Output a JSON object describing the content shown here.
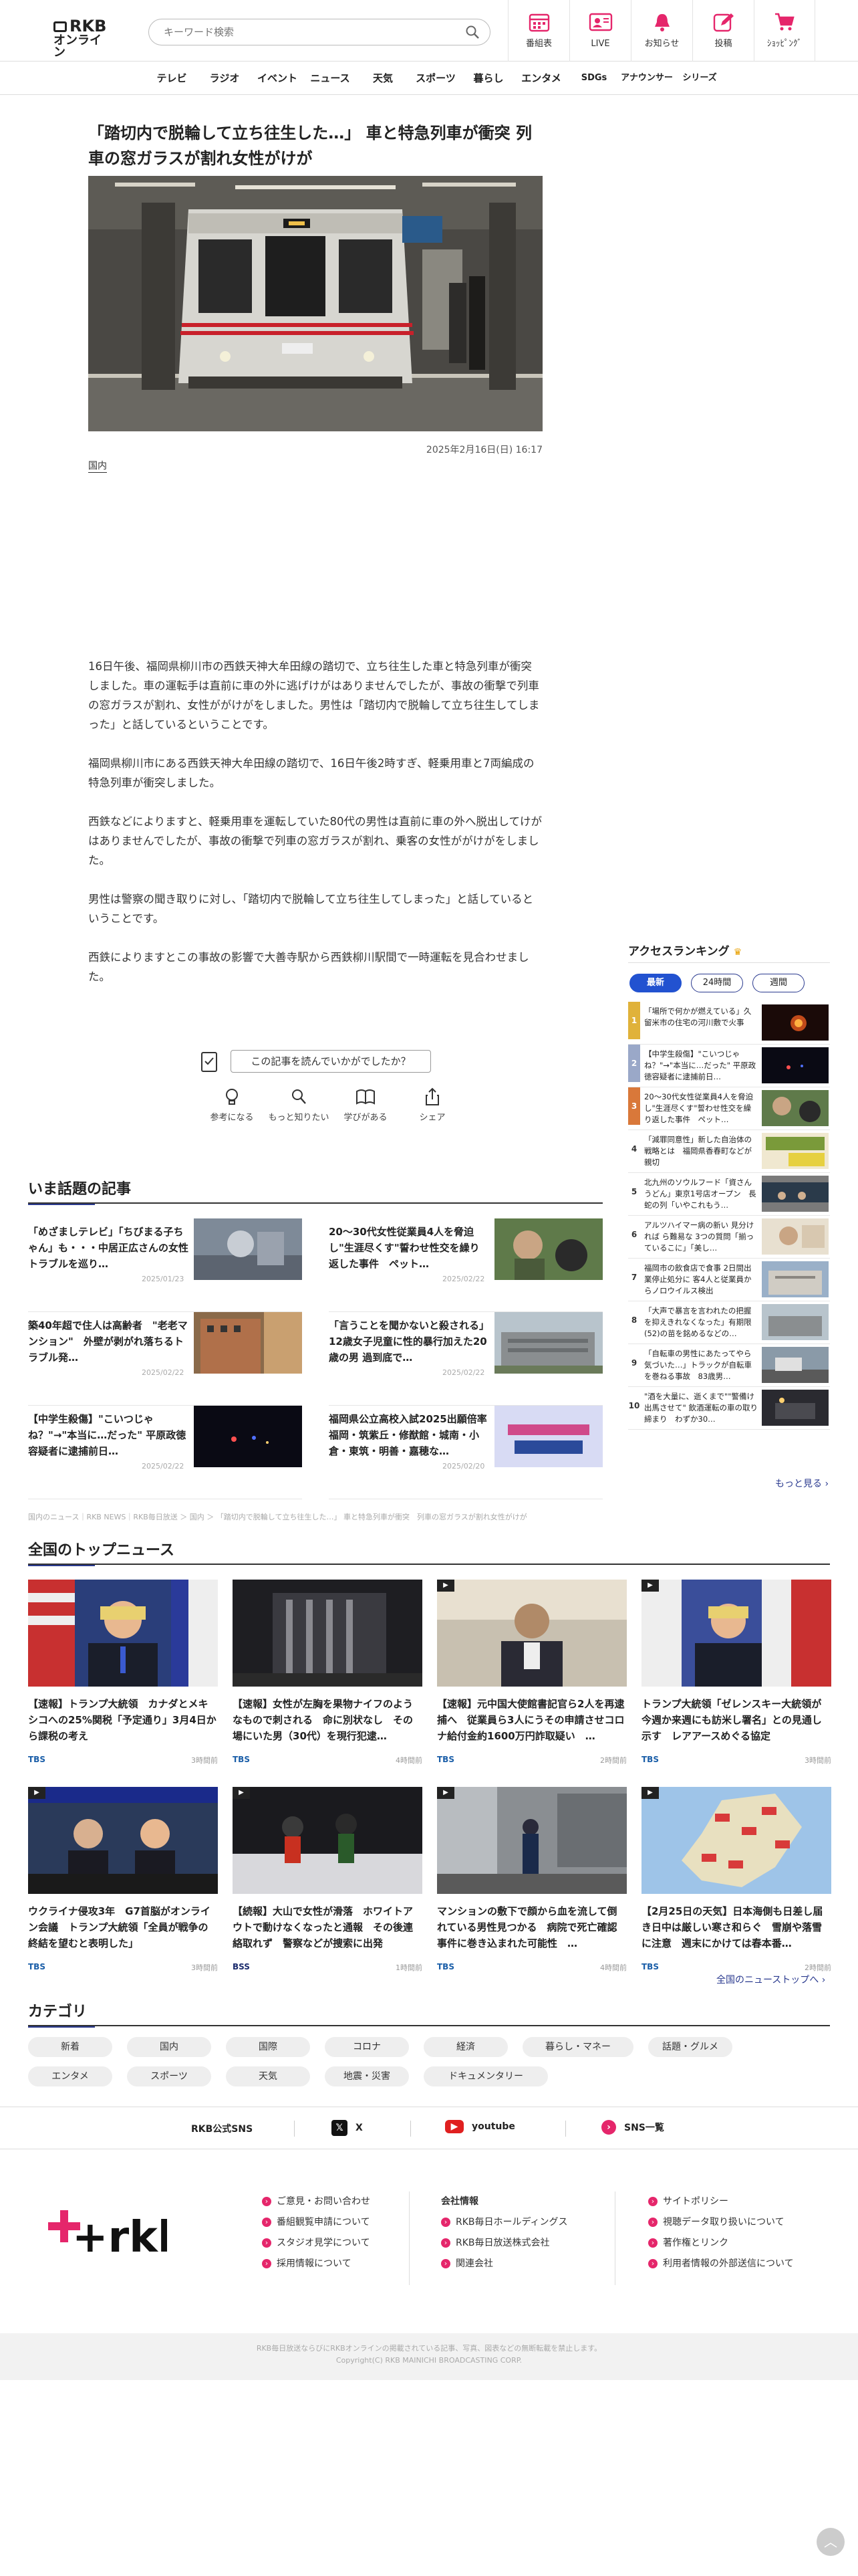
{
  "header": {
    "logo_line1": "RKB",
    "logo_line2": "オンライン",
    "search_placeholder": "キーワード検索",
    "icons": [
      {
        "label": "番組表",
        "icon": "calendar-icon"
      },
      {
        "label": "LIVE",
        "icon": "live-icon"
      },
      {
        "label": "お知らせ",
        "icon": "bell-icon"
      },
      {
        "label": "投稿",
        "icon": "post-icon"
      },
      {
        "label": "ｼｮｯﾋﾟﾝｸﾞ",
        "icon": "cart-icon"
      }
    ]
  },
  "nav": [
    "テレビ",
    "ラジオ",
    "イベント",
    "ニュース",
    "天気",
    "スポーツ",
    "暮らし",
    "エンタメ",
    "SDGs",
    "アナウンサー",
    "シリーズ"
  ],
  "article": {
    "title": "「踏切内で脱輪して立ち往生した…」 車と特急列車が衝突 列車の窓ガラスが割れ女性がけが",
    "date": "2025年2月16日(日) 16:17",
    "category": "国内",
    "paragraphs": [
      "16日午後、福岡県柳川市の西鉄天神大牟田線の踏切で、立ち往生した車と特急列車が衝突しました。車の運転手は直前に車の外に逃げけがはありませんでしたが、事故の衝撃で列車の窓ガラスが割れ、女性ががけがをしました。男性は「踏切内で脱輪して立ち往生してしまった」と話しているということです。",
      "福岡県柳川市にある西鉄天神大牟田線の踏切で、16日午後2時すぎ、軽乗用車と7両編成の特急列車が衝突しました。",
      "西鉄などによりますと、軽乗用車を運転していた80代の男性は直前に車の外へ脱出してけがはありませんでしたが、事故の衝撃で列車の窓ガラスが割れ、乗客の女性ががけがをしました。",
      "男性は警察の聞き取りに対し、「踏切内で脱輪して立ち往生してしまった」と話しているということです。",
      "西鉄によりますとこの事故の影響で大善寺駅から西鉄柳川駅間で一時運転を見合わせました。"
    ]
  },
  "survey": {
    "question": "この記事を読んでいかがでしたか？",
    "reactions": [
      {
        "label": "参考になる",
        "icon": "lightbulb-icon"
      },
      {
        "label": "もっと知りたい",
        "icon": "search-icon"
      },
      {
        "label": "学びがある",
        "icon": "book-icon"
      },
      {
        "label": "シェア",
        "icon": "share-icon"
      }
    ]
  },
  "popular": {
    "title": "いま話題の記事",
    "items": [
      {
        "title": "「めざましテレビ」「ちびまる子ちゃん」も・・・中居正広さんの女性トラブルを巡り…",
        "date": "2025/01/23"
      },
      {
        "title": "20～30代女性従業員4人を脅迫し\"生涯尽くす\"誓わせ性交を繰り返した事件　ペット…",
        "date": "2025/02/22"
      },
      {
        "title": "築40年超で住人は高齢者　\"老老マンション\"　外壁が剥がれ落ちるトラブル発…",
        "date": "2025/02/22"
      },
      {
        "title": "「言うことを聞かないと殺される」12歳女子児童に性的暴行加えた20歳の男 過到底で…",
        "date": "2025/02/22"
      },
      {
        "title": "【中学生殺傷】\"こいつじゃね？\"→\"本当に…だった\" 平原政徳容疑者に逮捕前日…",
        "date": "2025/02/22"
      },
      {
        "title": "福岡県公立高校入試2025出願倍率　福岡・筑紫丘・修猷館・城南・小倉・東筑・明善・嘉穂な…",
        "date": "2025/02/20"
      }
    ]
  },
  "breadcrumb": "国内のニュース｜RKB NEWS｜RKB毎日放送 ＞ 国内 ＞ 「踏切内で脱輪して立ち往生した…」 車と特急列車が衝突　列車の窓ガラスが割れ女性がけが",
  "ranking": {
    "title": "アクセスランキング",
    "crown": "♛",
    "tabs": [
      "最新",
      "24時間",
      "週間"
    ],
    "items": [
      {
        "n": "1",
        "title": "「場所で何かが燃えている」久留米市の住宅の河川敷で火事"
      },
      {
        "n": "2",
        "title": "【中学生殺傷】\"こいつじゃね？\"→\"本当に…だった\" 平原政徳容疑者に逮捕前日…"
      },
      {
        "n": "3",
        "title": "20～30代女性従業員4人を脅迫し\"生涯尽くす\"誓わせ性交を繰り返した事件　ペット…"
      },
      {
        "n": "4",
        "title": "「減罪同意性」新した自治体の戦略とは　福岡県香春町などが親切"
      },
      {
        "n": "5",
        "title": "北九州のソウルフード「資さんうどん」東京1号店オープン　長蛇の列「いやこれもう…"
      },
      {
        "n": "6",
        "title": "アルツハイマー病の新い 見分ければ ら難易な 3つの質問「揃っているこに」「美し…"
      },
      {
        "n": "7",
        "title": "福岡市の飲食店で食事 2日間出業停止処分に 客4人と従業員からノロウイルス検出"
      },
      {
        "n": "8",
        "title": "「大声で暴言を言われたの把握を抑えきれなくなった」有期限(52)の苗を銘めるなどの…"
      },
      {
        "n": "9",
        "title": "「自転車の男性にあたってやら気づいた…」トラックが自転車を巻ねる事故　83歳男…"
      },
      {
        "n": "10",
        "title": "\"酒を大量に、逝くまで\"\"警備け出馬させて\" 飲酒運転の車の取り締まり　わずか30…"
      }
    ],
    "more": "もっと見る"
  },
  "topnews": {
    "title": "全国のトップニュース",
    "items": [
      {
        "title": "【速報】トランプ大統領　カナダとメキシコへの25%関税「予定通り」3月4日から課税の考え",
        "src": "TBS",
        "time": "3時間前"
      },
      {
        "title": "【速報】女性が左胸を果物ナイフのようなもので刺される　命に別状なし　その場にいた男（30代）を現行犯逮…",
        "src": "TBS",
        "time": "4時間前"
      },
      {
        "title": "【速報】元中国大使館書記官ら2人を再逮捕へ　従業員ら3人にうその申請させコロナ給付金約1600万円詐取疑い　…",
        "src": "TBS",
        "time": "2時間前"
      },
      {
        "title": "トランプ大統領「ゼレンスキー大統領が今週か来週にも訪米し署名」との見通し示す　レアアースめぐる協定",
        "src": "TBS",
        "time": "3時間前"
      },
      {
        "title": "ウクライナ侵攻3年　G7首脳がオンライン会議　トランプ大統領「全員が戦争の終結を望むと表明した」",
        "src": "TBS",
        "time": "3時間前"
      },
      {
        "title": "【続報】大山で女性が滑落　ホワイトアウトで動けなくなったと通報　その後連絡取れず　警察などが捜索に出発",
        "src": "BSS",
        "time": "1時間前"
      },
      {
        "title": "マンションの敷下で顔から血を流して倒れている男性見つかる　病院で死亡確認　事件に巻き込まれた可能性　…",
        "src": "TBS",
        "time": "4時間前"
      },
      {
        "title": "【2月25日の天気】日本海側も日差し届き日中は厳しい寒さ和らぐ　雪崩や落雪に注意　週末にかけては春本番…",
        "src": "TBS",
        "time": "2時間前"
      }
    ],
    "more": "全国のニューストップへ"
  },
  "category": {
    "title": "カテゴリ",
    "chips": [
      "新着",
      "国内",
      "国際",
      "コロナ",
      "経済",
      "暮らし・マネー",
      "話題・グルメ",
      "エンタメ",
      "スポーツ",
      "天気",
      "地震・災害",
      "ドキュメンタリー"
    ]
  },
  "social": {
    "label": "RKB公式SNS",
    "links": [
      "X",
      "youtube",
      "SNS一覧"
    ]
  },
  "footer": {
    "logo": "+rkb",
    "col1": [
      "ご意見・お問い合わせ",
      "番組観覧申請について",
      "スタジオ見学について",
      "採用情報について"
    ],
    "col2_head": "会社情報",
    "col2": [
      "RKB毎日ホールディングス",
      "RKB毎日放送株式会社",
      "関連会社"
    ],
    "col3": [
      "サイトポリシー",
      "視聴データ取り扱いについて",
      "著作権とリンク",
      "利用者情報の外部送信について"
    ],
    "copy1": "RKB毎日放送ならびにRKBオンラインの掲載されている記事、写真、図表などの無断転載を禁止します。",
    "copy2": "Copyright(C) RKB MAINICHI BROADCASTING CORP."
  },
  "colors": {
    "accent": "#2a3a8f",
    "brand_pink": "#e5266b",
    "rank_tab_active": "#2252d0"
  }
}
